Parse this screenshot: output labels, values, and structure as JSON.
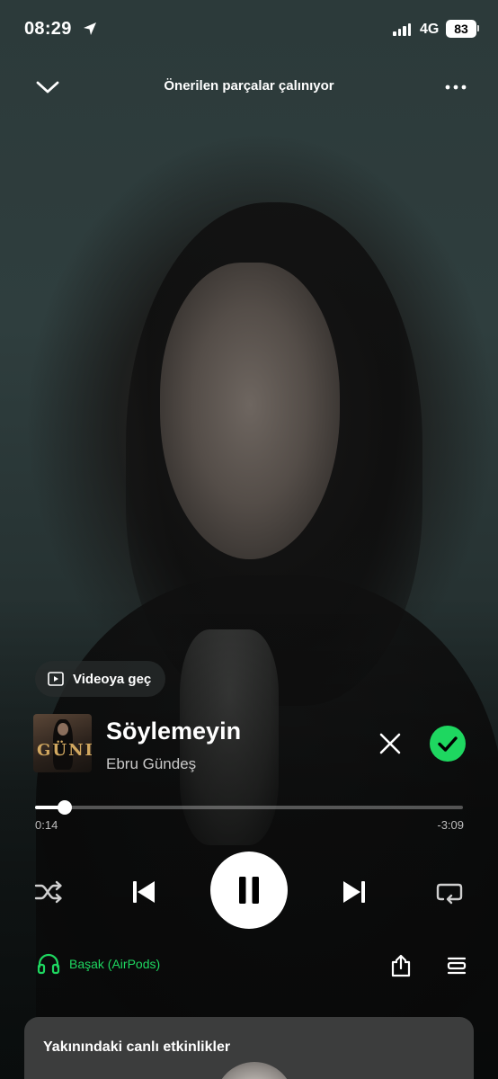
{
  "status_bar": {
    "time": "08:29",
    "network": "4G",
    "battery": "83"
  },
  "header": {
    "title": "Önerilen parçalar çalınıyor"
  },
  "video_switch": {
    "label": "Videoya geç"
  },
  "track": {
    "title": "Söylemeyin",
    "artist": "Ebru Gündeş",
    "cover_text": "GÜNDEŞ"
  },
  "playback": {
    "elapsed": "0:14",
    "remaining": "-3:09",
    "progress_fraction": 0.07,
    "state": "playing"
  },
  "device": {
    "name": "Başak (AirPods)"
  },
  "colors": {
    "accent": "#1ed760",
    "background": "#2f3e3e"
  },
  "card": {
    "title": "Yakınındaki canlı etkinlikler"
  },
  "icons": {
    "collapse": "chevron-down-icon",
    "more": "more-icon",
    "video": "video-icon",
    "dismiss": "close-icon",
    "saved": "check-circle-icon",
    "shuffle": "shuffle-icon",
    "previous": "skip-previous-icon",
    "pause": "pause-icon",
    "next": "skip-next-icon",
    "repeat": "repeat-icon",
    "headphones": "headphones-icon",
    "share": "share-icon",
    "queue": "queue-icon"
  }
}
